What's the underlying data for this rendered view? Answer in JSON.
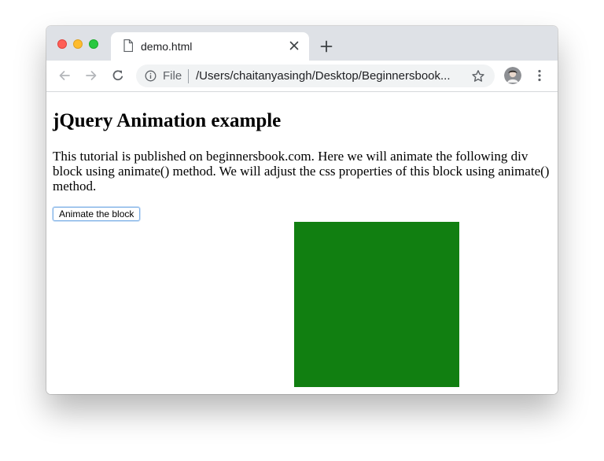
{
  "browser": {
    "tab": {
      "title": "demo.html",
      "icon": "document-icon"
    },
    "toolbar": {
      "scheme_label": "File",
      "url": "/Users/chaitanyasingh/Desktop/Beginnersbook...",
      "icons": [
        "back-arrow-icon",
        "forward-arrow-icon",
        "reload-icon",
        "info-icon",
        "star-icon",
        "avatar",
        "more-vert-icon"
      ]
    },
    "colors": {
      "tab_strip": "#dee1e6",
      "close": "#ff5f57",
      "minimize": "#febc2e",
      "maximize": "#28c840"
    }
  },
  "page": {
    "heading": "jQuery Animation example",
    "intro": "This tutorial is published on beginnersbook.com. Here we will animate the following div block using animate() method. We will adjust the css properties of this block using animate() method.",
    "button_label": "Animate the block",
    "block": {
      "color": "#117f11"
    }
  }
}
